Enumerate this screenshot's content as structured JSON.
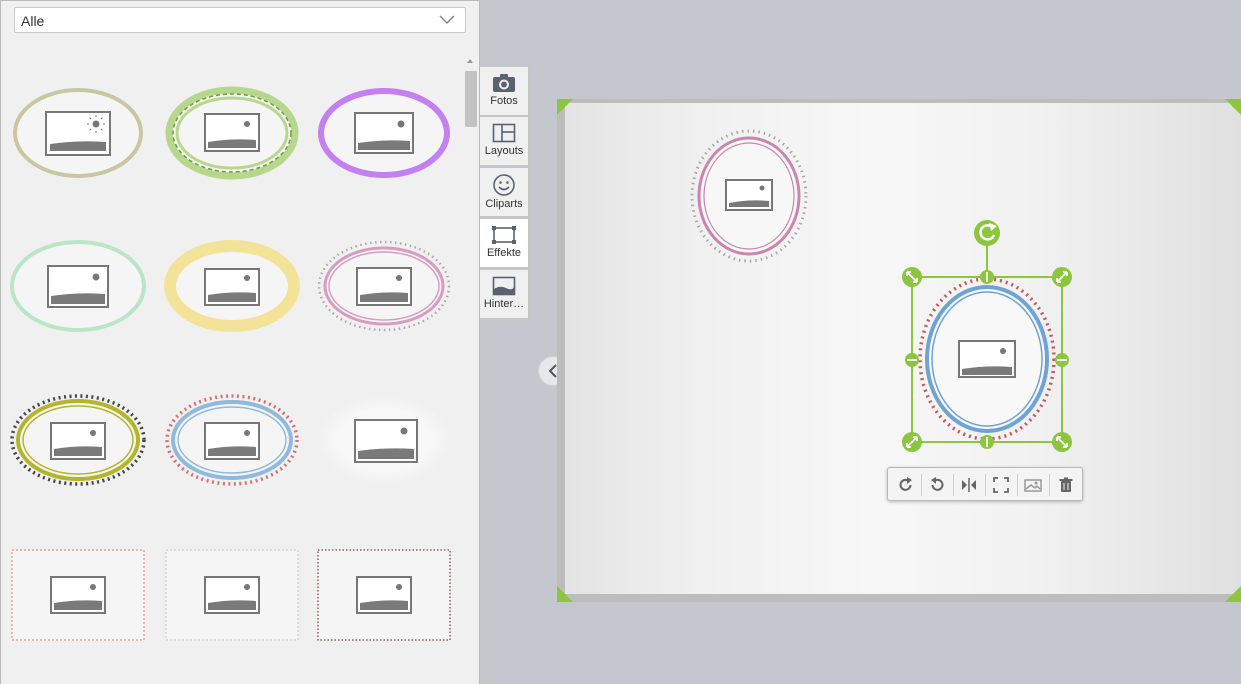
{
  "effects_panel": {
    "filter_value": "Alle"
  },
  "tabs": [
    {
      "label": "Fotos",
      "icon": "camera-icon"
    },
    {
      "label": "Layouts",
      "icon": "layout-icon"
    },
    {
      "label": "Cliparts",
      "icon": "smiley-icon"
    },
    {
      "label": "Effekte",
      "icon": "frame-effect-icon",
      "active": true
    },
    {
      "label": "Hinter…",
      "icon": "background-icon"
    }
  ],
  "toolbar": {
    "items": [
      "rotate-right-icon",
      "rotate-left-icon",
      "flip-icon",
      "fit-icon",
      "replace-photo-icon",
      "trash-icon"
    ]
  },
  "colors": {
    "selection": "#8cc63f",
    "panel_bg": "#f0f0f0",
    "workspace_bg": "#c4c7cd"
  }
}
